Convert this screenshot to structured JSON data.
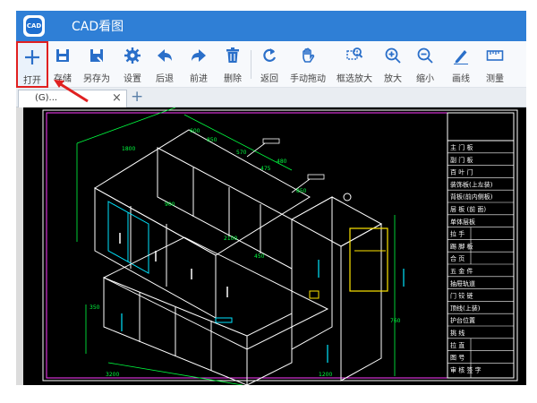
{
  "app": {
    "title": "CAD看图",
    "logo_text": "CAD"
  },
  "toolbar": {
    "items": [
      {
        "label": "打开",
        "icon": "plus-icon"
      },
      {
        "label": "存储",
        "icon": "save-icon"
      },
      {
        "label": "另存为",
        "icon": "save-as-icon"
      },
      {
        "label": "设置",
        "icon": "gear-icon"
      },
      {
        "label": "后退",
        "icon": "back-arrow-icon"
      },
      {
        "label": "前进",
        "icon": "forward-arrow-icon"
      },
      {
        "label": "删除",
        "icon": "trash-icon"
      },
      {
        "label": "返回",
        "icon": "return-icon"
      },
      {
        "label": "手动拖动",
        "icon": "hand-icon"
      },
      {
        "label": "框选放大",
        "icon": "box-zoom-icon"
      },
      {
        "label": "放大",
        "icon": "zoom-in-icon"
      },
      {
        "label": "缩小",
        "icon": "zoom-out-icon"
      },
      {
        "label": "画线",
        "icon": "pencil-icon"
      },
      {
        "label": "测量",
        "icon": "ruler-icon"
      }
    ]
  },
  "tabs": [
    {
      "label": "(G)...",
      "close": "×"
    }
  ],
  "add_tab": "+",
  "drawing": {
    "title_block_rows": [
      "主 门 板",
      "副 门 板",
      "百 叶 门",
      "装饰板(上左装)",
      "背板(前内侧板)",
      "层 板 (前 面)",
      "单体层板",
      "拉 手",
      "踢 脚 板",
      "合 页",
      "五 金 件",
      "抽屉轨道",
      "门 铰 链",
      "顶线(上装)",
      "护台位置",
      "挑 线",
      "拉 直",
      "图 号",
      "审 核 签 字"
    ],
    "labels": [
      "1800",
      "600",
      "850",
      "570",
      "475",
      "480",
      "850",
      "900",
      "2100",
      "450",
      "350",
      "3200",
      "1200",
      "760"
    ],
    "colors": {
      "outline": "#ffffff",
      "cyan": "#00e5ff",
      "green": "#00ff40",
      "yellow": "#ffe600",
      "magenta": "#ff3cff"
    }
  }
}
